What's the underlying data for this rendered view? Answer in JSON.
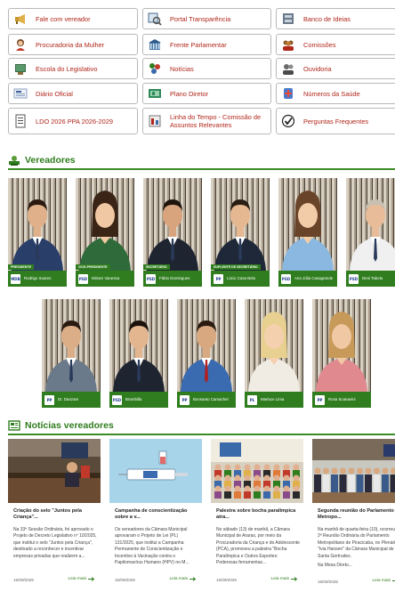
{
  "quick_links": [
    {
      "label": "Fale com vereador",
      "icon": "megaphone-icon"
    },
    {
      "label": "Portal Transparência",
      "icon": "magnifier-chart-icon"
    },
    {
      "label": "Banco de Ideias",
      "icon": "ideas-archive-icon"
    },
    {
      "label": "Procuradoria da Mulher",
      "icon": "woman-icon"
    },
    {
      "label": "Frente Parlamentar",
      "icon": "building-icon"
    },
    {
      "label": "Comissões",
      "icon": "group-icon"
    },
    {
      "label": "Escola do Legislativo",
      "icon": "school-icon"
    },
    {
      "label": "Notícias",
      "icon": "news-icon"
    },
    {
      "label": "Ouvidoria",
      "icon": "ombudsman-icon"
    },
    {
      "label": "Diário Oficial",
      "icon": "gazette-icon"
    },
    {
      "label": "Plano Diretor",
      "icon": "plan-icon"
    },
    {
      "label": "Números da Saúde",
      "icon": "health-icon"
    },
    {
      "label": "LDO 2026 PPA 2026-2029",
      "icon": "document-icon"
    },
    {
      "label": "Linha do Tempo - Comissão de Assuntos Relevantes",
      "icon": "timeline-icon"
    },
    {
      "label": "Perguntas Frequentes",
      "icon": "checkmark-icon"
    }
  ],
  "sections": {
    "councillors_title": "Vereadores",
    "news_title": "Notícias vereadores"
  },
  "councillors_row1": [
    {
      "name": "Rodrigo Soares",
      "role": "PRESIDENTE",
      "party": "MDB"
    },
    {
      "name": "Miriam Vanessa",
      "role": "VICE-PRESIDENTE",
      "party": "PSD"
    },
    {
      "name": "Fábio Domingues",
      "role": "SECRETÁRIO",
      "party": "PSD"
    },
    {
      "name": "Lúcio Casa Bela",
      "role": "SUPLENTE DE SECRETÁRIO",
      "party": "PP"
    },
    {
      "name": "Ana Júlia Casagrande",
      "role": "",
      "party": "PSD"
    },
    {
      "name": "Deni Tabela",
      "role": "",
      "party": "PSD"
    }
  ],
  "councillors_row2": [
    {
      "name": "Dr. Danzani",
      "role": "",
      "party": "PP"
    },
    {
      "name": "Brambilla",
      "role": "",
      "party": "PSD"
    },
    {
      "name": "Bonsanto Camachel",
      "role": "",
      "party": "PP"
    },
    {
      "name": "Marluce Lima",
      "role": "",
      "party": "PL"
    },
    {
      "name": "Rosa Scanavini",
      "role": "",
      "party": "PP"
    }
  ],
  "news": [
    {
      "title": "Criação do selo \"Juntos pela Criança\"...",
      "text": "Na 33ª Sessão Ordinária, foi aprovado o Projeto de Decreto Legislativo nº 10/2025, que institui o selo \"Juntos pela Criança\", destinado a reconhecer e incentivar empresas privadas que realizem a...",
      "date": "15/09/2025",
      "more": "Leia mais"
    },
    {
      "title": "Campanha de conscientização sobre a v...",
      "text": "Os vereadores da Câmara Municipal aprovaram o Projeto de Lei (PL) 131/2025, que institui a Campanha Permanente de Conscientização e Incentivo à Vacinação contra o Papilomavírus Humano (HPV) no M...",
      "date": "15/09/2025",
      "more": "Leia mais"
    },
    {
      "title": "Palestra sobre bocha paralímpica atra...",
      "text": "No sábado (13) de manhã, a Câmara Municipal de Araras, por meio da Procuradoria da Criança e do Adolescente (PCA), promoveu a palestra \"Bocha Paralímpica e Outros Esportes: Poderosas ferramentas...",
      "date": "15/09/2025",
      "more": "Leia mais"
    },
    {
      "title": "Segunda reunião do Parlamento Metropo...",
      "text": "Na manhã de quarta-feira (10), ocorreu a 2ª Reunião Ordinária do Parlamento Metropolitano de Piracicaba, no Plenário \"Ivia Hansen\" da Câmara Municipal de Santa Gertrudes.",
      "text2": "Na Mesa Direto...",
      "date": "15/09/2025",
      "more": "Leia mais"
    }
  ],
  "colors": {
    "brand_green": "#2f7d1e",
    "link_red": "#b0261b"
  }
}
